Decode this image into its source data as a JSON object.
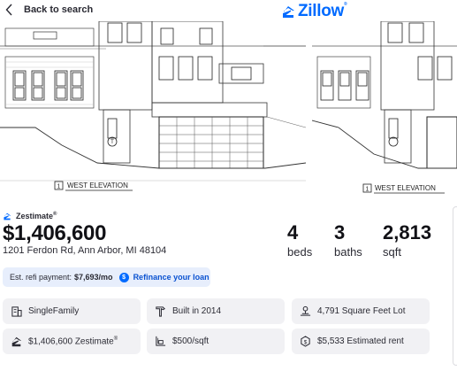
{
  "header": {
    "back_label": "Back to search",
    "logo_text": "Zillow",
    "logo_mark": "®",
    "back_icon": "chevron-left-icon",
    "logo_icon": "zillow-z-icon",
    "brand_color": "#006aff"
  },
  "gallery": {
    "main_caption": "WEST ELEVATION",
    "side_caption": "WEST ELEVATION"
  },
  "listing": {
    "zestimate_label": "Zestimate",
    "zestimate_mark": "®",
    "price": "$1,406,600",
    "address": "1201 Ferdon Rd, Ann Arbor, MI 48104",
    "beds_value": "4",
    "beds_label": "beds",
    "baths_value": "3",
    "baths_label": "baths",
    "sqft_value": "2,813",
    "sqft_label": "sqft"
  },
  "refi": {
    "label": "Est. refi payment:",
    "amount": "$7,693/mo",
    "icon_text": "$",
    "link": "Refinance your loan"
  },
  "facts": [
    {
      "icon": "building-icon",
      "text": "SingleFamily"
    },
    {
      "icon": "hammer-icon",
      "text": "Built in 2014"
    },
    {
      "icon": "lot-size-icon",
      "text": "4,791 Square Feet Lot"
    },
    {
      "icon": "zestimate-icon",
      "text": "$1,406,600 Zestimate",
      "mark": "®"
    },
    {
      "icon": "price-per-sqft-icon",
      "text": "$500/sqft"
    },
    {
      "icon": "rent-icon",
      "text": "$5,533 Estimated rent"
    }
  ]
}
